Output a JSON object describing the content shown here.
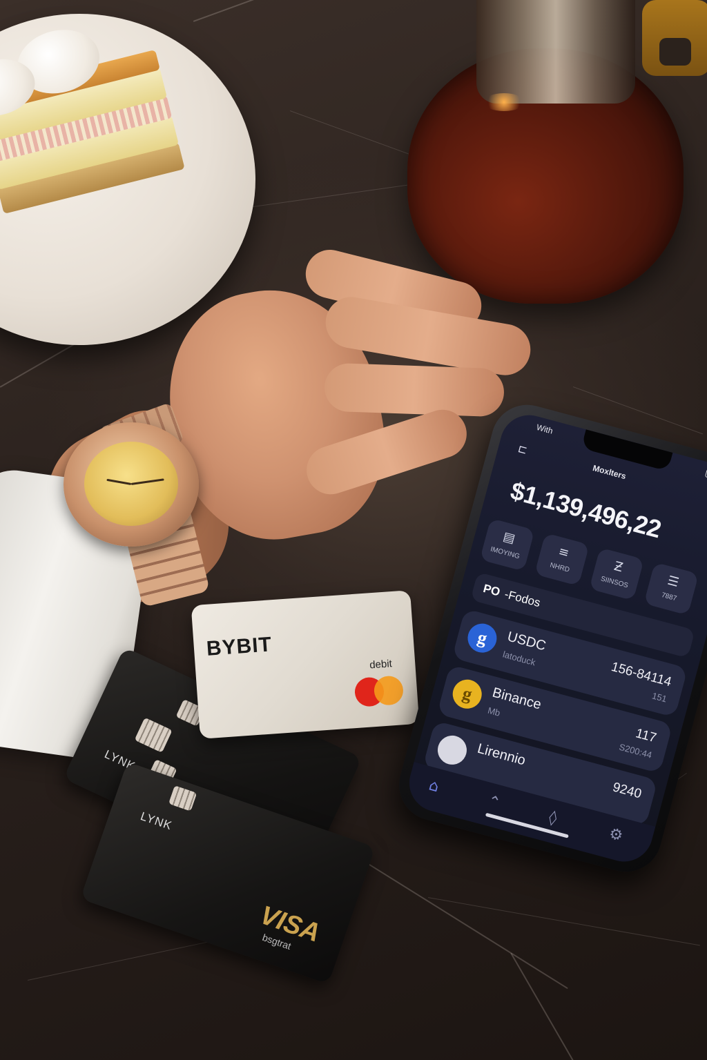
{
  "bybit_card": {
    "brand": "BYBIT",
    "type_label": "debit",
    "network_colors": [
      "#e0251b",
      "#f59a1b"
    ]
  },
  "lynk_cards": [
    {
      "brand": "LYNK"
    },
    {
      "brand": "LYNK",
      "network": "VISA",
      "network_sub": "bsgtrat"
    }
  ],
  "phone": {
    "status_left": "With",
    "app_title": "Moxlters",
    "balance": "$1,139,496,22",
    "quick_actions": [
      {
        "icon": "card-icon",
        "glyph": "▤",
        "label": "IMOYING"
      },
      {
        "icon": "list-icon",
        "glyph": "≡",
        "label": "NHRD"
      },
      {
        "icon": "z-icon",
        "glyph": "Ƶ",
        "label": "SIINSOS"
      },
      {
        "icon": "menu-icon",
        "glyph": "☰",
        "label": "7887"
      }
    ],
    "section": {
      "prefix": "PO",
      "title": "-Fodos"
    },
    "assets": [
      {
        "name": "USDC",
        "sub": "latoduck",
        "value": "156-84114",
        "sub_value": "151",
        "coin_letter": "g",
        "coin_color": "#2a63d6"
      },
      {
        "name": "Binance",
        "sub": "Mb",
        "value": "117",
        "sub_value": "S200:44",
        "coin_letter": "g",
        "coin_color": "#e8b320"
      },
      {
        "name": "Lirennio",
        "sub": "",
        "value": "9240",
        "sub_value": "",
        "coin_letter": "",
        "coin_color": "#d8d8e2"
      }
    ],
    "tabs": [
      "home-icon",
      "arrow-up-icon",
      "drop-icon",
      "settings-icon"
    ]
  },
  "colors": {
    "screen_bg": "#1e2036",
    "accent_blue": "#2a63d6",
    "accent_gold": "#e8b320",
    "visa_gold": "#caa24f"
  }
}
